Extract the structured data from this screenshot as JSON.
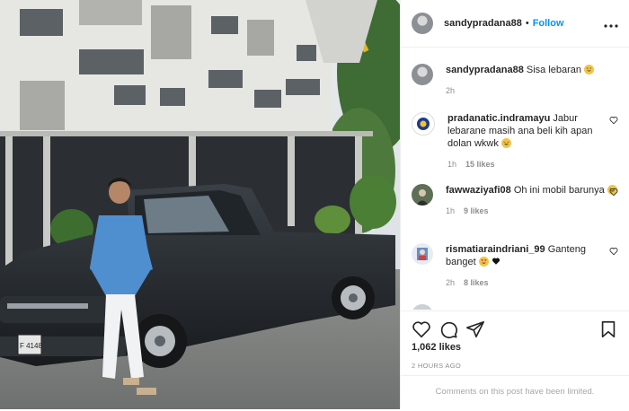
{
  "photo": {
    "plate": "F 4148"
  },
  "header": {
    "username": "sandypradana88",
    "separator": "•",
    "follow_label": "Follow",
    "more_label": "•••"
  },
  "caption": {
    "username": "sandypradana88",
    "text": "Sisa lebaran",
    "emoji": "grinning-face",
    "time": "2h"
  },
  "comments": [
    {
      "username": "pradanatic.indramayu",
      "text": "Jabur lebarane masih ana beli kih apan dolan wkwk",
      "emoji": "laughing-face",
      "time": "1h",
      "likes": "15 likes"
    },
    {
      "username": "fawwaziyafi08",
      "text": "Oh ini mobil barunya",
      "emoji": "laughing-face",
      "time": "1h",
      "likes": "9 likes"
    },
    {
      "username": "rismatiaraindriani_99",
      "text": "Ganteng banget",
      "emoji": "heart-eyes-face black-heart",
      "time": "2h",
      "likes": "8 likes"
    }
  ],
  "actions": {
    "likes": "1,062 likes",
    "time_ago": "2 HOURS AGO",
    "comments_limited": "Comments on this post have been limited."
  },
  "colors": {
    "accent": "#0095f6",
    "text": "#262626",
    "muted": "#8e8e8e",
    "border": "#efefef",
    "truck": "#1e2226"
  }
}
